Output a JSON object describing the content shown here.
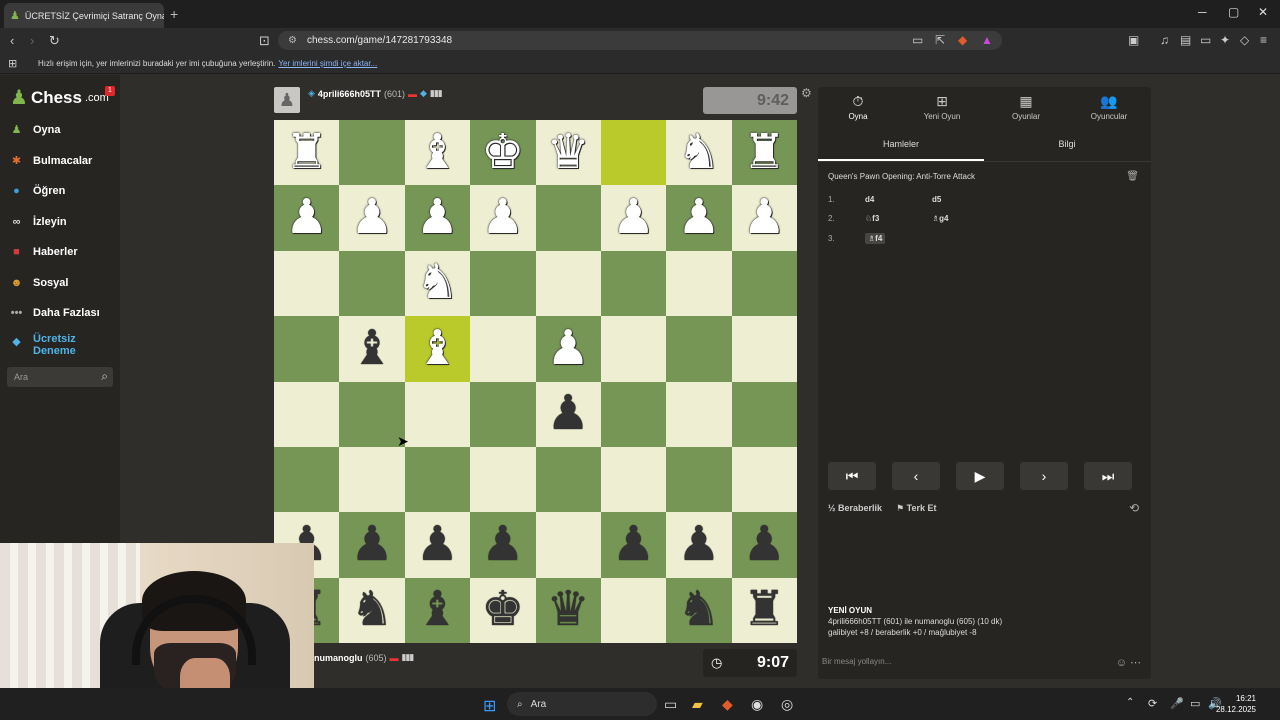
{
  "browser": {
    "tab_title": "ÜCRETSİZ Çevrimiçi Satranç Oyna",
    "url": "chess.com/game/147281793348",
    "bookmarks_text": "Hızlı erişim için, yer imlerinizi buradaki yer imi çubuğuna yerleştirin.",
    "bookmarks_link": "Yer imlerini şimdi içe aktar..."
  },
  "sidebar": {
    "logo_text": "Chess",
    "logo_domain": ".com",
    "notif_count": "1",
    "items": [
      {
        "label": "Oyna",
        "icon": "play-icon",
        "color": "#81b64c"
      },
      {
        "label": "Bulmacalar",
        "icon": "puzzle-icon",
        "color": "#e86c2b"
      },
      {
        "label": "Öğren",
        "icon": "learn-icon",
        "color": "#3aa0d8"
      },
      {
        "label": "İzleyin",
        "icon": "binoculars-icon",
        "color": "#d9d9d9"
      },
      {
        "label": "Haberler",
        "icon": "news-icon",
        "color": "#d23b3b"
      },
      {
        "label": "Sosyal",
        "icon": "social-icon",
        "color": "#e0a030"
      },
      {
        "label": "Daha Fazlası",
        "icon": "more-icon",
        "color": "#aaaaaa"
      }
    ],
    "trial_label": "Ücretsiz Deneme",
    "search_placeholder": "Ara"
  },
  "top_player": {
    "name": "4prili666h05TT",
    "rating": "(601)",
    "clock": "9:42"
  },
  "bottom_player": {
    "name": "numanoglu",
    "rating": "(605)",
    "clock": "9:07"
  },
  "board": {
    "rows": [
      [
        "wR",
        "",
        "wB",
        "wK",
        "wQ",
        "",
        "wN",
        "wR"
      ],
      [
        "wP",
        "wP",
        "wP",
        "wP",
        "",
        "wP",
        "wP",
        "wP"
      ],
      [
        "",
        "",
        "wN",
        "",
        "",
        "",
        "",
        ""
      ],
      [
        "",
        "bB",
        "wB",
        "",
        "wP",
        "",
        "",
        ""
      ],
      [
        "",
        "",
        "",
        "",
        "bP",
        "",
        "",
        ""
      ],
      [
        "",
        "",
        "",
        "",
        "",
        "",
        "",
        ""
      ],
      [
        "bP",
        "bP",
        "bP",
        "bP",
        "",
        "bP",
        "bP",
        "bP"
      ],
      [
        "bR",
        "bN",
        "bB",
        "bK",
        "bQ",
        "",
        "bN",
        "bR"
      ]
    ],
    "highlights": [
      "0-5",
      "3-2"
    ]
  },
  "panel": {
    "tabs": [
      "Oyna",
      "Yeni Oyun",
      "Oyunlar",
      "Oyuncular"
    ],
    "subtabs": [
      "Hamleler",
      "Bilgi"
    ],
    "opening": "Queen's Pawn Opening: Anti-Torre Attack",
    "moves": [
      {
        "num": "1.",
        "white": "d4",
        "black": "d5"
      },
      {
        "num": "2.",
        "white": "♘f3",
        "black": "♗g4"
      },
      {
        "num": "3.",
        "white": "♗f4",
        "black": ""
      }
    ],
    "draw_label": "Beraberlik",
    "resign_label": "Terk Et",
    "new_game_title": "YENİ OYUN",
    "new_game_line1": "4prili666h05TT (601) ile numanoglu (605) (10 dk)",
    "new_game_line2": "galibiyet +8 / beraberlik +0 / mağlubiyet -8",
    "chat_placeholder": "Bir mesaj yollayın..."
  },
  "taskbar": {
    "search_label": "Ara",
    "time": "16:21",
    "date": "28.12.2025"
  }
}
